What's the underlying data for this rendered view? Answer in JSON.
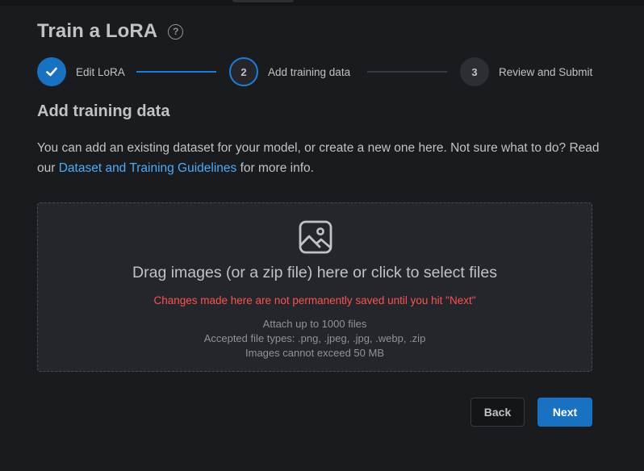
{
  "header": {
    "title": "Train a LoRA",
    "help_icon": "help-circle-icon"
  },
  "stepper": {
    "steps": [
      {
        "number": "1",
        "label": "Edit LoRA",
        "state": "completed"
      },
      {
        "number": "2",
        "label": "Add training data",
        "state": "active"
      },
      {
        "number": "3",
        "label": "Review and Submit",
        "state": "pending"
      }
    ]
  },
  "section": {
    "title": "Add training data",
    "description_prefix": "You can add an existing dataset for your model, or create a new one here. Not sure what to do? Read our ",
    "link_text": "Dataset and Training Guidelines",
    "description_suffix": " for more info."
  },
  "dropzone": {
    "icon": "image-icon",
    "main_text": "Drag images (or a zip file) here or click to select files",
    "warning": "Changes made here are not permanently saved until you hit \"Next\"",
    "info_limit": "Attach up to 1000 files",
    "info_types": "Accepted file types: .png, .jpeg, .jpg, .webp, .zip",
    "info_size": "Images cannot exceed 50 MB"
  },
  "actions": {
    "back_label": "Back",
    "next_label": "Next"
  },
  "colors": {
    "background": "#1a1b1e",
    "accent": "#1971c2",
    "link": "#4dabf7",
    "warning": "#fa5252"
  }
}
